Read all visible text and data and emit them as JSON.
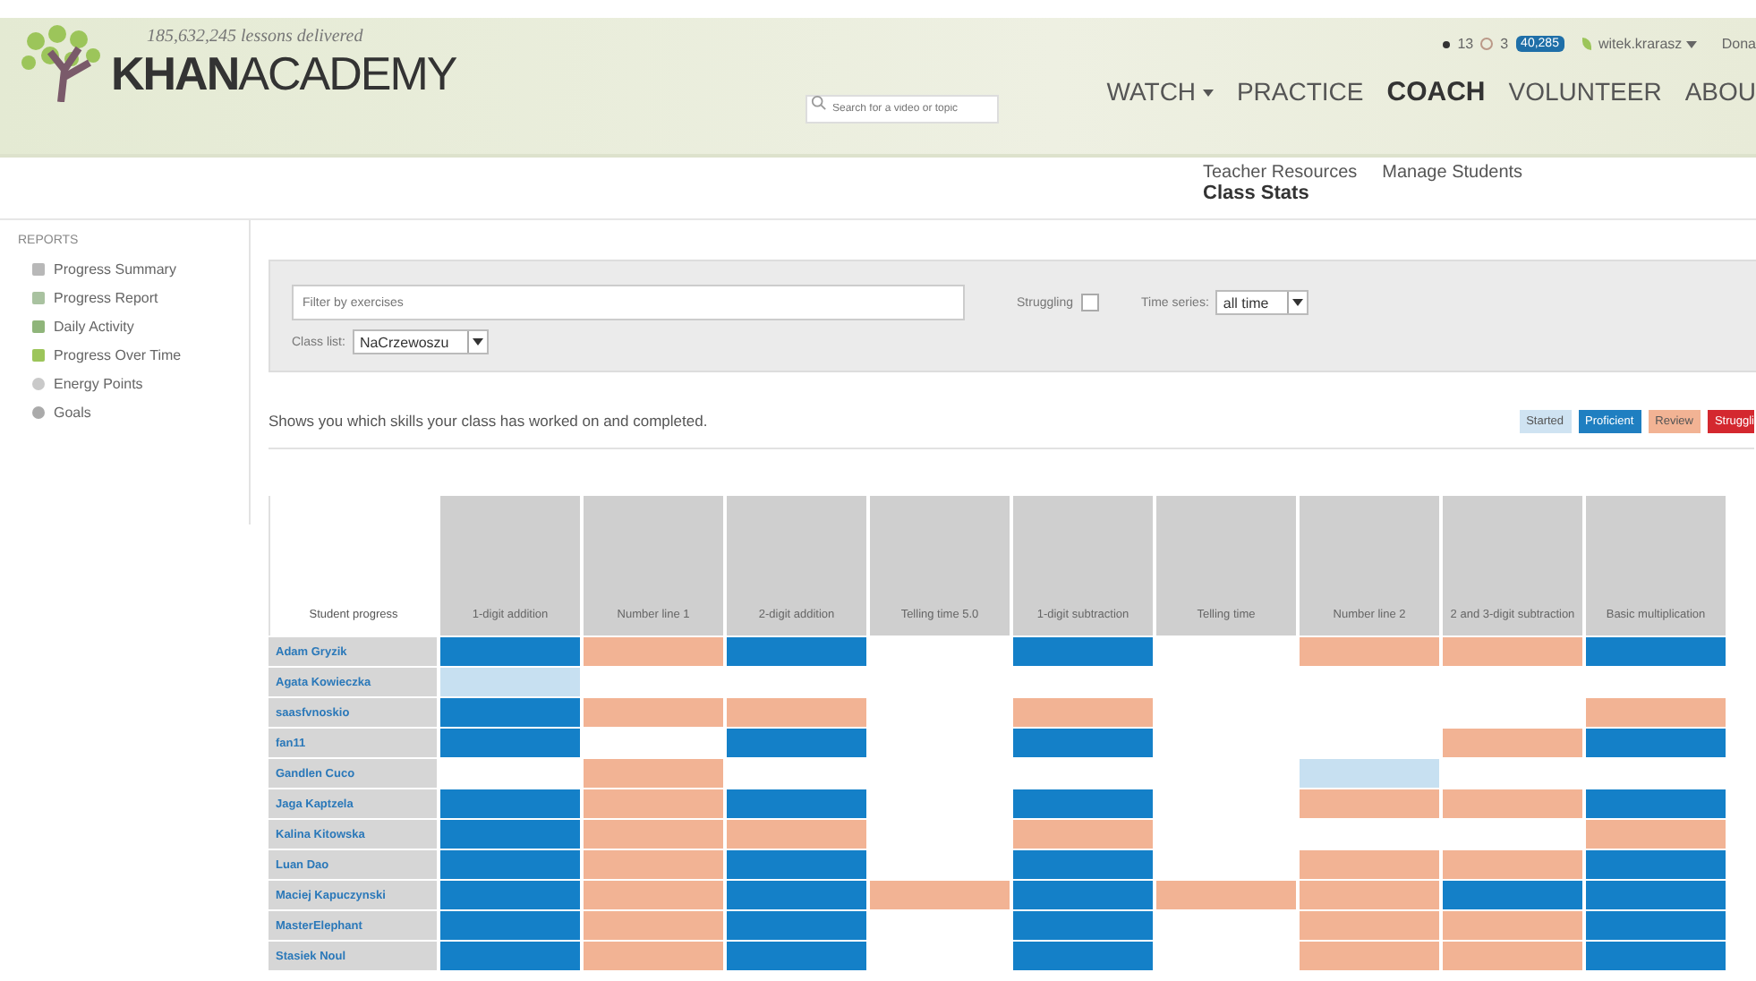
{
  "header": {
    "tagline": "185,632,245 lessons delivered",
    "logo_bold": "KHAN",
    "logo_light": "ACADEMY",
    "search": {
      "placeholder": "Search for a video or topic"
    },
    "user_bar": {
      "streak": "13",
      "badges": "3",
      "points": "40,285",
      "username": "witek.krarasz",
      "donate": "Dona"
    },
    "nav": [
      {
        "label": "WATCH",
        "dropdown": true,
        "selected": false
      },
      {
        "label": "PRACTICE",
        "dropdown": false,
        "selected": false
      },
      {
        "label": "COACH",
        "dropdown": false,
        "selected": true
      },
      {
        "label": "VOLUNTEER",
        "dropdown": false,
        "selected": false
      },
      {
        "label": "ABOU",
        "dropdown": false,
        "selected": false
      }
    ]
  },
  "subnav": [
    {
      "label": "Teacher Resources",
      "selected": false
    },
    {
      "label": "Manage Students",
      "selected": false
    },
    {
      "label": "Class Stats",
      "selected": true
    }
  ],
  "sidebar": {
    "heading": "REPORTS",
    "items": [
      {
        "label": "Progress Summary",
        "kind": "summary"
      },
      {
        "label": "Progress Report",
        "kind": "report"
      },
      {
        "label": "Daily Activity",
        "kind": "activity"
      },
      {
        "label": "Progress Over Time",
        "kind": "time"
      },
      {
        "label": "Energy Points",
        "kind": "energy"
      },
      {
        "label": "Goals",
        "kind": "goals"
      }
    ]
  },
  "filters": {
    "exercise_filter": {
      "placeholder": "Filter by exercises"
    },
    "struggling": {
      "label": "Struggling",
      "checked": false
    },
    "time_series": {
      "label": "Time series:",
      "value": "all time"
    },
    "class_list": {
      "label": "Class list:",
      "value": "NaCrzewoszu"
    }
  },
  "description": "Shows you which skills your class has worked on and completed.",
  "legend": [
    {
      "label": "Started",
      "kind": "started"
    },
    {
      "label": "Proficient",
      "kind": "proficient"
    },
    {
      "label": "Review",
      "kind": "review"
    },
    {
      "label": "Struggli",
      "kind": "struggling"
    }
  ],
  "table": {
    "corner": "Student progress",
    "columns": [
      "1-digit addition",
      "Number line 1",
      "2-digit addition",
      "Telling time 5.0",
      "1-digit subtraction",
      "Telling time",
      "Number line 2",
      "2 and 3-digit subtraction",
      "Basic multiplication"
    ],
    "rows": [
      {
        "student": "Adam Gryzik",
        "cells": [
          {
            "kind": "proficient"
          },
          {
            "kind": "review"
          },
          {
            "kind": "proficient"
          },
          {
            "kind": "none"
          },
          {
            "kind": "proficient"
          },
          {
            "kind": "none"
          },
          {
            "kind": "review"
          },
          {
            "kind": "review"
          },
          {
            "kind": "proficient"
          }
        ]
      },
      {
        "student": "Agata Kowieczka",
        "cells": [
          {
            "kind": "started"
          },
          {
            "kind": "none"
          },
          {
            "kind": "none"
          },
          {
            "kind": "none"
          },
          {
            "kind": "none"
          },
          {
            "kind": "none"
          },
          {
            "kind": "none"
          },
          {
            "kind": "none"
          },
          {
            "kind": "none"
          }
        ]
      },
      {
        "student": "saasfvnoskio",
        "cells": [
          {
            "kind": "proficient"
          },
          {
            "kind": "review"
          },
          {
            "kind": "review"
          },
          {
            "kind": "none"
          },
          {
            "kind": "review"
          },
          {
            "kind": "none"
          },
          {
            "kind": "none"
          },
          {
            "kind": "none"
          },
          {
            "kind": "review"
          }
        ]
      },
      {
        "student": "fan11",
        "cells": [
          {
            "kind": "proficient"
          },
          {
            "kind": "none"
          },
          {
            "kind": "proficient"
          },
          {
            "kind": "none"
          },
          {
            "kind": "proficient"
          },
          {
            "kind": "none"
          },
          {
            "kind": "none"
          },
          {
            "kind": "review"
          },
          {
            "kind": "proficient"
          }
        ]
      },
      {
        "student": "Gandlen Cuco",
        "cells": [
          {
            "kind": "none"
          },
          {
            "kind": "review"
          },
          {
            "kind": "none"
          },
          {
            "kind": "none"
          },
          {
            "kind": "none"
          },
          {
            "kind": "none"
          },
          {
            "kind": "started"
          },
          {
            "kind": "none"
          },
          {
            "kind": "none"
          }
        ]
      },
      {
        "student": "Jaga Kaptzela",
        "cells": [
          {
            "kind": "proficient"
          },
          {
            "kind": "review"
          },
          {
            "kind": "proficient"
          },
          {
            "kind": "none"
          },
          {
            "kind": "proficient"
          },
          {
            "kind": "none"
          },
          {
            "kind": "review"
          },
          {
            "kind": "review"
          },
          {
            "kind": "proficient"
          }
        ]
      },
      {
        "student": "Kalina Kitowska",
        "cells": [
          {
            "kind": "proficient"
          },
          {
            "kind": "review"
          },
          {
            "kind": "review"
          },
          {
            "kind": "none"
          },
          {
            "kind": "review"
          },
          {
            "kind": "none"
          },
          {
            "kind": "none"
          },
          {
            "kind": "none"
          },
          {
            "kind": "review"
          }
        ]
      },
      {
        "student": "Luan Dao",
        "cells": [
          {
            "kind": "proficient"
          },
          {
            "kind": "review"
          },
          {
            "kind": "proficient"
          },
          {
            "kind": "none"
          },
          {
            "kind": "proficient"
          },
          {
            "kind": "none"
          },
          {
            "kind": "review"
          },
          {
            "kind": "review"
          },
          {
            "kind": "proficient"
          }
        ]
      },
      {
        "student": "Maciej Kapuczynski",
        "cells": [
          {
            "kind": "proficient"
          },
          {
            "kind": "review"
          },
          {
            "kind": "proficient"
          },
          {
            "kind": "review"
          },
          {
            "kind": "proficient"
          },
          {
            "kind": "review"
          },
          {
            "kind": "review"
          },
          {
            "kind": "proficient"
          },
          {
            "kind": "proficient"
          }
        ]
      },
      {
        "student": "MasterElephant",
        "cells": [
          {
            "kind": "proficient"
          },
          {
            "kind": "review"
          },
          {
            "kind": "proficient"
          },
          {
            "kind": "none"
          },
          {
            "kind": "proficient"
          },
          {
            "kind": "none"
          },
          {
            "kind": "review"
          },
          {
            "kind": "review"
          },
          {
            "kind": "proficient"
          }
        ]
      },
      {
        "student": "Stasiek Noul",
        "cells": [
          {
            "kind": "proficient"
          },
          {
            "kind": "review"
          },
          {
            "kind": "proficient"
          },
          {
            "kind": "none"
          },
          {
            "kind": "proficient"
          },
          {
            "kind": "none"
          },
          {
            "kind": "review"
          },
          {
            "kind": "review"
          },
          {
            "kind": "proficient"
          }
        ]
      }
    ]
  }
}
